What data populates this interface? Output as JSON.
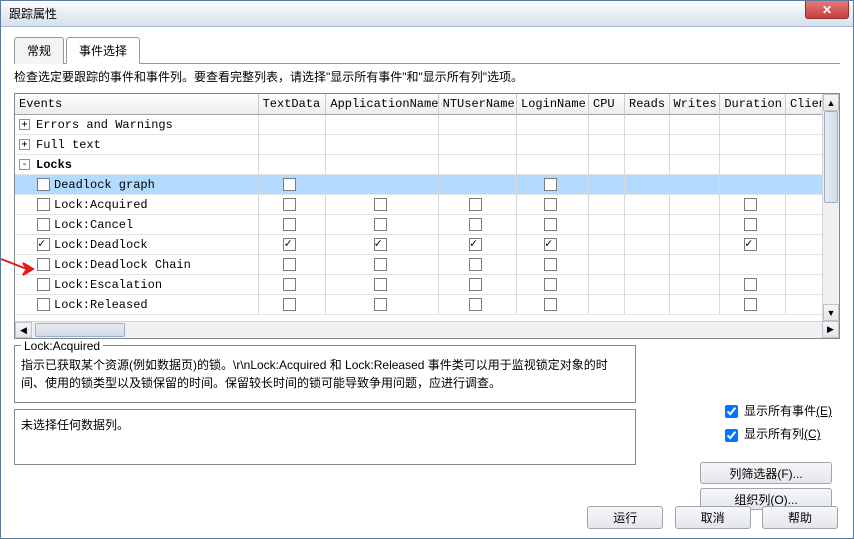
{
  "title": "跟踪属性",
  "tabs": {
    "general": "常规",
    "events": "事件选择"
  },
  "instruction": "检查选定要跟踪的事件和事件列。要查看完整列表，请选择\"显示所有事件\"和\"显示所有列\"选项。",
  "columns": [
    "Events",
    "TextData",
    "ApplicationName",
    "NTUserName",
    "LoginName",
    "CPU",
    "Reads",
    "Writes",
    "Duration",
    "ClientP"
  ],
  "groups": {
    "errors": {
      "label": "Errors and Warnings",
      "expanded": false
    },
    "fulltext": {
      "label": "Full text",
      "expanded": false
    },
    "locks": {
      "label": "Locks",
      "expanded": true
    }
  },
  "rows": {
    "deadlock_graph": {
      "label": "Deadlock graph",
      "evt": false,
      "cols": {
        "TextData": false,
        "LoginName": false
      }
    },
    "lock_acquired": {
      "label": "Lock:Acquired",
      "evt": false,
      "cols": {
        "TextData": false,
        "ApplicationName": false,
        "NTUserName": false,
        "LoginName": false,
        "Duration": false
      }
    },
    "lock_cancel": {
      "label": "Lock:Cancel",
      "evt": false,
      "cols": {
        "TextData": false,
        "ApplicationName": false,
        "NTUserName": false,
        "LoginName": false,
        "Duration": false
      }
    },
    "lock_deadlock": {
      "label": "Lock:Deadlock",
      "evt": true,
      "cols": {
        "TextData": true,
        "ApplicationName": true,
        "NTUserName": true,
        "LoginName": true,
        "Duration": true
      }
    },
    "lock_deadlock_ch": {
      "label": "Lock:Deadlock Chain",
      "evt": false,
      "cols": {
        "TextData": false,
        "ApplicationName": false,
        "NTUserName": false,
        "LoginName": false
      }
    },
    "lock_escalation": {
      "label": "Lock:Escalation",
      "evt": false,
      "cols": {
        "TextData": false,
        "ApplicationName": false,
        "NTUserName": false,
        "LoginName": false,
        "Duration": false
      }
    },
    "lock_released": {
      "label": "Lock:Released",
      "evt": false,
      "cols": {
        "TextData": false,
        "ApplicationName": false,
        "NTUserName": false,
        "LoginName": false,
        "Duration": false
      }
    }
  },
  "desc": {
    "legend": "Lock:Acquired",
    "text": "指示已获取某个资源(例如数据页)的锁。\\r\\nLock:Acquired 和 Lock:Released 事件类可以用于监视锁定对象的时间、使用的锁类型以及锁保留的时间。保留较长时间的锁可能导致争用问题，应进行调查。"
  },
  "show_all_events": {
    "label_pre": "显示所有事件",
    "accel": "(E)",
    "checked": true
  },
  "show_all_cols": {
    "label_pre": "显示所有列",
    "accel": "(C)",
    "checked": true
  },
  "nocols_text": "未选择任何数据列。",
  "btn_colfilter": "列筛选器(F)...",
  "btn_organize": "组织列(O)...",
  "btn_run": "运行",
  "btn_cancel": "取消",
  "btn_help": "帮助"
}
